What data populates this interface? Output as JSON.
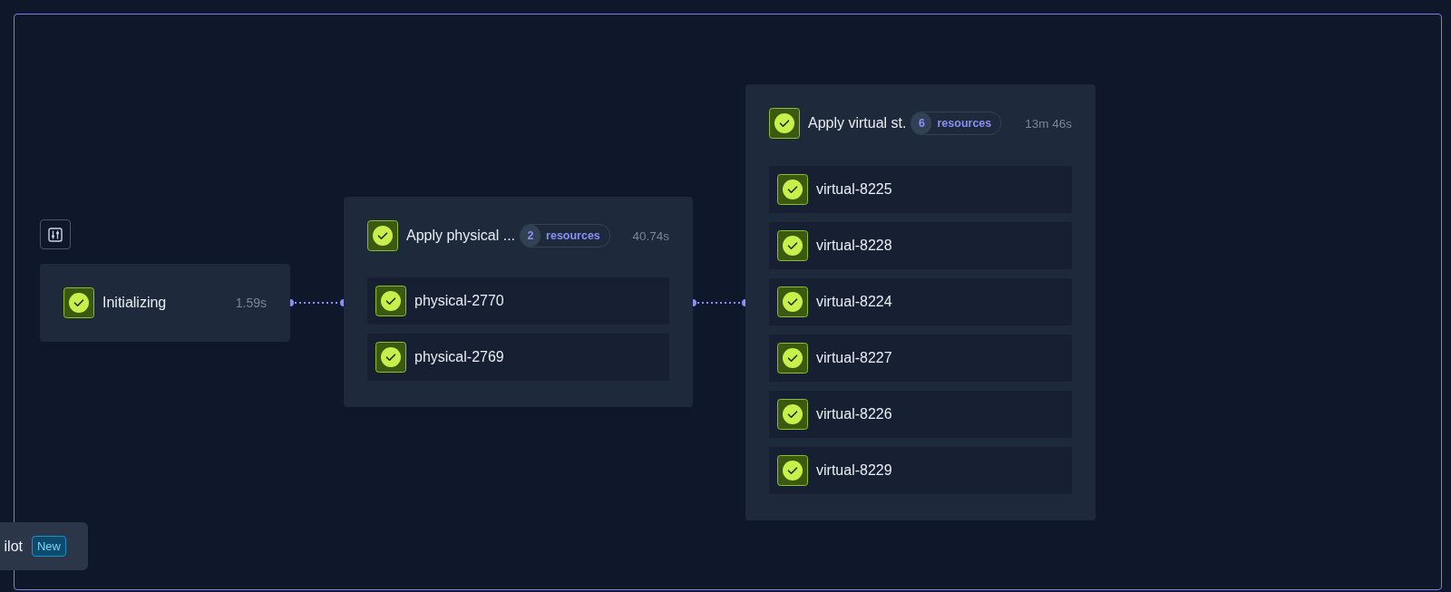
{
  "nodes": [
    {
      "kind": "step",
      "completed": true,
      "title": "Initializing",
      "duration": "1.59s"
    },
    {
      "kind": "group",
      "completed": true,
      "title": "Apply physical ...",
      "count": "2",
      "count_label": "resources",
      "duration": "40.74s",
      "children": [
        {
          "completed": true,
          "title": "physical-2770"
        },
        {
          "completed": true,
          "title": "physical-2769"
        }
      ]
    },
    {
      "kind": "group",
      "completed": true,
      "title": "Apply virtual st.",
      "count": "6",
      "count_label": "resources",
      "duration": "13m 46s",
      "children": [
        {
          "completed": true,
          "title": "virtual-8225"
        },
        {
          "completed": true,
          "title": "virtual-8228"
        },
        {
          "completed": true,
          "title": "virtual-8224"
        },
        {
          "completed": true,
          "title": "virtual-8227"
        },
        {
          "completed": true,
          "title": "virtual-8226"
        },
        {
          "completed": true,
          "title": "virtual-8229"
        }
      ]
    }
  ],
  "copilot_button": {
    "label": "ilot",
    "badge": "New"
  }
}
